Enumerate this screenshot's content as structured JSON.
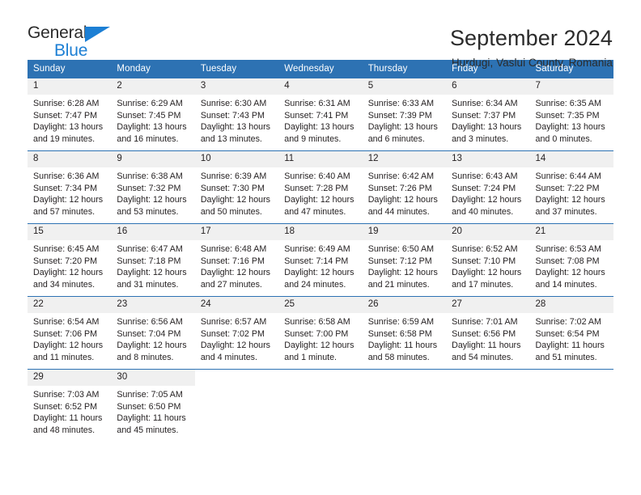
{
  "brand": {
    "word_one": "General",
    "word_two": "Blue",
    "accent_color": "#1c7fd4"
  },
  "header": {
    "title": "September 2024",
    "subtitle": "Hurdugi, Vaslui County, Romania"
  },
  "colors": {
    "header_blue": "#2d72b3",
    "day_number_band": "#f0f0f0",
    "text": "#231f20"
  },
  "calendar": {
    "weekday_headers": [
      "Sunday",
      "Monday",
      "Tuesday",
      "Wednesday",
      "Thursday",
      "Friday",
      "Saturday"
    ],
    "weeks": [
      [
        {
          "day": "1",
          "sunrise": "Sunrise: 6:28 AM",
          "sunset": "Sunset: 7:47 PM",
          "daylight_line1": "Daylight: 13 hours",
          "daylight_line2": "and 19 minutes."
        },
        {
          "day": "2",
          "sunrise": "Sunrise: 6:29 AM",
          "sunset": "Sunset: 7:45 PM",
          "daylight_line1": "Daylight: 13 hours",
          "daylight_line2": "and 16 minutes."
        },
        {
          "day": "3",
          "sunrise": "Sunrise: 6:30 AM",
          "sunset": "Sunset: 7:43 PM",
          "daylight_line1": "Daylight: 13 hours",
          "daylight_line2": "and 13 minutes."
        },
        {
          "day": "4",
          "sunrise": "Sunrise: 6:31 AM",
          "sunset": "Sunset: 7:41 PM",
          "daylight_line1": "Daylight: 13 hours",
          "daylight_line2": "and 9 minutes."
        },
        {
          "day": "5",
          "sunrise": "Sunrise: 6:33 AM",
          "sunset": "Sunset: 7:39 PM",
          "daylight_line1": "Daylight: 13 hours",
          "daylight_line2": "and 6 minutes."
        },
        {
          "day": "6",
          "sunrise": "Sunrise: 6:34 AM",
          "sunset": "Sunset: 7:37 PM",
          "daylight_line1": "Daylight: 13 hours",
          "daylight_line2": "and 3 minutes."
        },
        {
          "day": "7",
          "sunrise": "Sunrise: 6:35 AM",
          "sunset": "Sunset: 7:35 PM",
          "daylight_line1": "Daylight: 13 hours",
          "daylight_line2": "and 0 minutes."
        }
      ],
      [
        {
          "day": "8",
          "sunrise": "Sunrise: 6:36 AM",
          "sunset": "Sunset: 7:34 PM",
          "daylight_line1": "Daylight: 12 hours",
          "daylight_line2": "and 57 minutes."
        },
        {
          "day": "9",
          "sunrise": "Sunrise: 6:38 AM",
          "sunset": "Sunset: 7:32 PM",
          "daylight_line1": "Daylight: 12 hours",
          "daylight_line2": "and 53 minutes."
        },
        {
          "day": "10",
          "sunrise": "Sunrise: 6:39 AM",
          "sunset": "Sunset: 7:30 PM",
          "daylight_line1": "Daylight: 12 hours",
          "daylight_line2": "and 50 minutes."
        },
        {
          "day": "11",
          "sunrise": "Sunrise: 6:40 AM",
          "sunset": "Sunset: 7:28 PM",
          "daylight_line1": "Daylight: 12 hours",
          "daylight_line2": "and 47 minutes."
        },
        {
          "day": "12",
          "sunrise": "Sunrise: 6:42 AM",
          "sunset": "Sunset: 7:26 PM",
          "daylight_line1": "Daylight: 12 hours",
          "daylight_line2": "and 44 minutes."
        },
        {
          "day": "13",
          "sunrise": "Sunrise: 6:43 AM",
          "sunset": "Sunset: 7:24 PM",
          "daylight_line1": "Daylight: 12 hours",
          "daylight_line2": "and 40 minutes."
        },
        {
          "day": "14",
          "sunrise": "Sunrise: 6:44 AM",
          "sunset": "Sunset: 7:22 PM",
          "daylight_line1": "Daylight: 12 hours",
          "daylight_line2": "and 37 minutes."
        }
      ],
      [
        {
          "day": "15",
          "sunrise": "Sunrise: 6:45 AM",
          "sunset": "Sunset: 7:20 PM",
          "daylight_line1": "Daylight: 12 hours",
          "daylight_line2": "and 34 minutes."
        },
        {
          "day": "16",
          "sunrise": "Sunrise: 6:47 AM",
          "sunset": "Sunset: 7:18 PM",
          "daylight_line1": "Daylight: 12 hours",
          "daylight_line2": "and 31 minutes."
        },
        {
          "day": "17",
          "sunrise": "Sunrise: 6:48 AM",
          "sunset": "Sunset: 7:16 PM",
          "daylight_line1": "Daylight: 12 hours",
          "daylight_line2": "and 27 minutes."
        },
        {
          "day": "18",
          "sunrise": "Sunrise: 6:49 AM",
          "sunset": "Sunset: 7:14 PM",
          "daylight_line1": "Daylight: 12 hours",
          "daylight_line2": "and 24 minutes."
        },
        {
          "day": "19",
          "sunrise": "Sunrise: 6:50 AM",
          "sunset": "Sunset: 7:12 PM",
          "daylight_line1": "Daylight: 12 hours",
          "daylight_line2": "and 21 minutes."
        },
        {
          "day": "20",
          "sunrise": "Sunrise: 6:52 AM",
          "sunset": "Sunset: 7:10 PM",
          "daylight_line1": "Daylight: 12 hours",
          "daylight_line2": "and 17 minutes."
        },
        {
          "day": "21",
          "sunrise": "Sunrise: 6:53 AM",
          "sunset": "Sunset: 7:08 PM",
          "daylight_line1": "Daylight: 12 hours",
          "daylight_line2": "and 14 minutes."
        }
      ],
      [
        {
          "day": "22",
          "sunrise": "Sunrise: 6:54 AM",
          "sunset": "Sunset: 7:06 PM",
          "daylight_line1": "Daylight: 12 hours",
          "daylight_line2": "and 11 minutes."
        },
        {
          "day": "23",
          "sunrise": "Sunrise: 6:56 AM",
          "sunset": "Sunset: 7:04 PM",
          "daylight_line1": "Daylight: 12 hours",
          "daylight_line2": "and 8 minutes."
        },
        {
          "day": "24",
          "sunrise": "Sunrise: 6:57 AM",
          "sunset": "Sunset: 7:02 PM",
          "daylight_line1": "Daylight: 12 hours",
          "daylight_line2": "and 4 minutes."
        },
        {
          "day": "25",
          "sunrise": "Sunrise: 6:58 AM",
          "sunset": "Sunset: 7:00 PM",
          "daylight_line1": "Daylight: 12 hours",
          "daylight_line2": "and 1 minute."
        },
        {
          "day": "26",
          "sunrise": "Sunrise: 6:59 AM",
          "sunset": "Sunset: 6:58 PM",
          "daylight_line1": "Daylight: 11 hours",
          "daylight_line2": "and 58 minutes."
        },
        {
          "day": "27",
          "sunrise": "Sunrise: 7:01 AM",
          "sunset": "Sunset: 6:56 PM",
          "daylight_line1": "Daylight: 11 hours",
          "daylight_line2": "and 54 minutes."
        },
        {
          "day": "28",
          "sunrise": "Sunrise: 7:02 AM",
          "sunset": "Sunset: 6:54 PM",
          "daylight_line1": "Daylight: 11 hours",
          "daylight_line2": "and 51 minutes."
        }
      ],
      [
        {
          "day": "29",
          "sunrise": "Sunrise: 7:03 AM",
          "sunset": "Sunset: 6:52 PM",
          "daylight_line1": "Daylight: 11 hours",
          "daylight_line2": "and 48 minutes."
        },
        {
          "day": "30",
          "sunrise": "Sunrise: 7:05 AM",
          "sunset": "Sunset: 6:50 PM",
          "daylight_line1": "Daylight: 11 hours",
          "daylight_line2": "and 45 minutes."
        },
        {
          "day": "",
          "sunrise": "",
          "sunset": "",
          "daylight_line1": "",
          "daylight_line2": ""
        },
        {
          "day": "",
          "sunrise": "",
          "sunset": "",
          "daylight_line1": "",
          "daylight_line2": ""
        },
        {
          "day": "",
          "sunrise": "",
          "sunset": "",
          "daylight_line1": "",
          "daylight_line2": ""
        },
        {
          "day": "",
          "sunrise": "",
          "sunset": "",
          "daylight_line1": "",
          "daylight_line2": ""
        },
        {
          "day": "",
          "sunrise": "",
          "sunset": "",
          "daylight_line1": "",
          "daylight_line2": ""
        }
      ]
    ]
  }
}
